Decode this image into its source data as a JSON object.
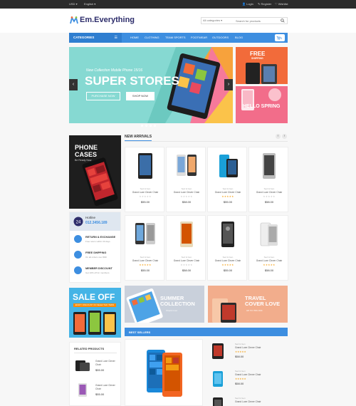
{
  "topbar": {
    "currency": "USD",
    "language": "English",
    "links": [
      "Login",
      "Register",
      "Wishlist"
    ]
  },
  "header": {
    "logo_text": "Em.Everything",
    "search_category": "All categories",
    "search_placeholder": "Search for products"
  },
  "nav": {
    "categories_label": "CATEGORIES",
    "items": [
      "HOME",
      "CLOTHING",
      "TEAM SPORTS",
      "FOOTWEAR",
      "OUTDOORS",
      "BLOG"
    ],
    "cart_count": "0"
  },
  "hero": {
    "subtitle": "New Collection Mobile Phone 15/16",
    "title": "SUPER STORES",
    "purchase_label": "PURCHASE NOW",
    "shop_label": "SHOP NOW",
    "slide_count": 4,
    "active_slide": 1
  },
  "side_banners": {
    "top_title": "FREE",
    "top_sub": "SHIPPING",
    "bottom_title": "HELLO SPRING"
  },
  "phone_cases": {
    "title_line1": "PHONE",
    "title_line2": "CASES",
    "subtitle": "Be Ready Now"
  },
  "hotline": {
    "label": "Hotline",
    "number": "012.3456.189"
  },
  "features": [
    {
      "title": "RETURN & EXCHANGE",
      "sub": "Free return within 30 days"
    },
    {
      "title": "FREE SHIPPING",
      "sub": "On all orders over $99"
    },
    {
      "title": "MEMBER DISCOUNT",
      "sub": "Get 10% off for members"
    }
  ],
  "sale": {
    "title": "SALE OFF",
    "sub": "ENJOY DISCOUNT ON SELECTED ITEMS"
  },
  "related": {
    "title": "RELATED PRODUCTS",
    "items": [
      {
        "name": "Grand Luxe Clever Chair",
        "price": "$55.00"
      },
      {
        "name": "Grand Luxe Clever Chair",
        "price": "$55.00"
      }
    ]
  },
  "new_arrivals": {
    "title": "NEW ARRIVALS",
    "products": [
      {
        "brand": "Sed & Gen",
        "name": "Grand Luxe Clever Chair",
        "price": "$55.00",
        "rated": false
      },
      {
        "brand": "Sed & Gen",
        "name": "Grand Luxe Clever Chair",
        "price": "$58.00",
        "rated": false
      },
      {
        "brand": "Sed & Gen",
        "name": "Grand Luxe Clever Chair",
        "price": "$55.00",
        "rated": true
      },
      {
        "brand": "Sed & Gen",
        "name": "Grand Luxe Clever Chair",
        "price": "$58.00",
        "rated": false
      },
      {
        "brand": "Sed & Gen",
        "name": "Grand Luxe Clever Chair",
        "price": "$55.00",
        "rated": true
      },
      {
        "brand": "Sed & Gen",
        "name": "Grand Luxe Clever Chair",
        "price": "$58.00",
        "rated": false
      },
      {
        "brand": "Sed & Gen",
        "name": "Grand Luxe Clever Chair",
        "price": "$55.00",
        "rated": true
      },
      {
        "brand": "Sed & Gen",
        "name": "Grand Luxe Clever Chair",
        "price": "$58.00",
        "rated": true
      }
    ]
  },
  "promos": [
    {
      "title_line1": "SUMMER",
      "title_line2": "COLLECTION",
      "sub": "Check it out"
    },
    {
      "title_line1": "TRAVEL",
      "title_line2": "COVER LOVE",
      "sub": "UP TO 70% OFF"
    }
  ],
  "best_sellers": {
    "title": "BEST SELLERS",
    "items": [
      {
        "brand": "Sed & Gen",
        "name": "Grand Luxe Clever Chair",
        "price": "$58.00"
      },
      {
        "brand": "Sed & Gen",
        "name": "Grand Luxe Clever Chair",
        "price": "$58.00"
      },
      {
        "brand": "Sed & Gen",
        "name": "Grand Luxe Clever Chair",
        "price": "$58.00"
      }
    ]
  },
  "icons": {
    "search": "search-icon",
    "cart": "cart-icon",
    "menu": "hamburger-icon",
    "prev": "chevron-left-icon",
    "next": "chevron-right-icon"
  },
  "colors": {
    "accent": "#3d8ee0",
    "topbar": "#2b2b2b",
    "sale_orange": "#f26b3a",
    "pink": "#f26d8a",
    "star": "#f5a623"
  }
}
